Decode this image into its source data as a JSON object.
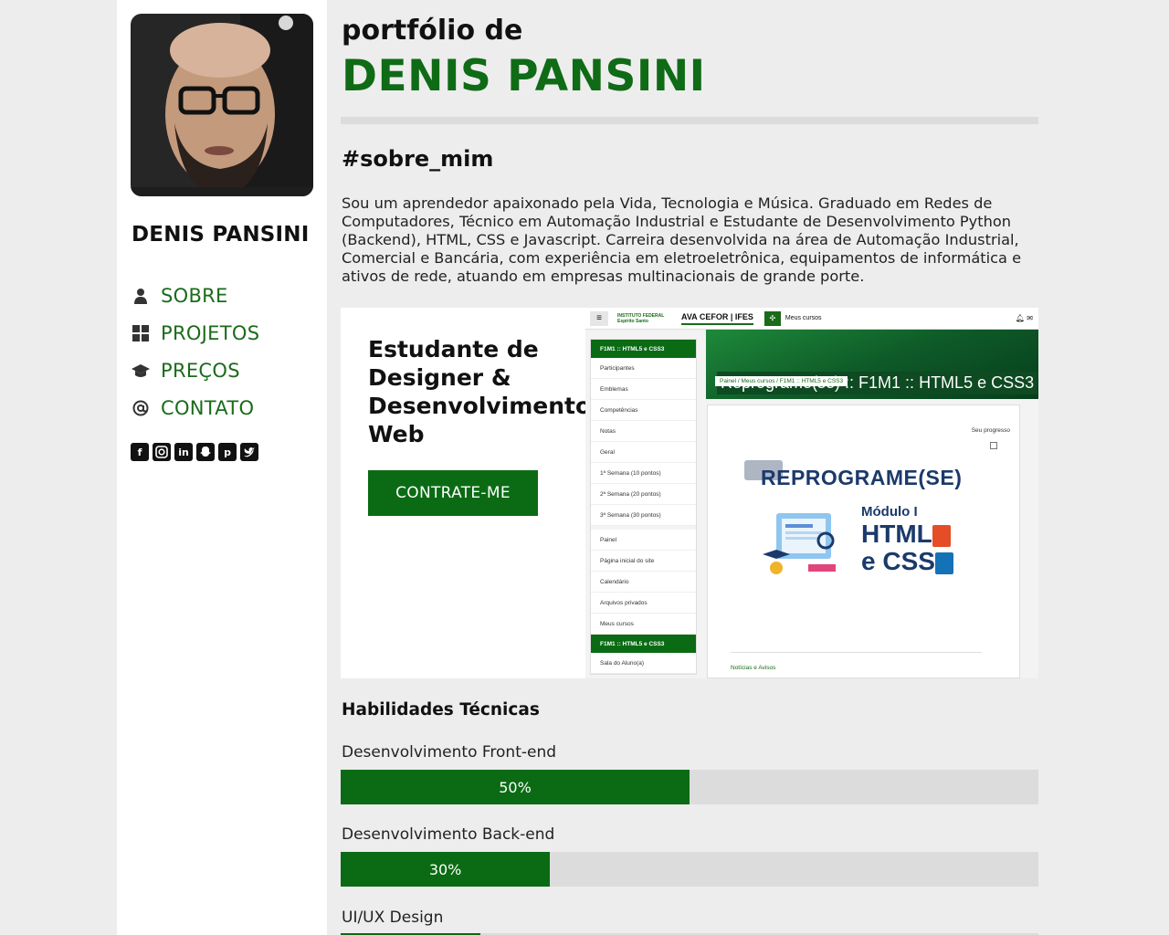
{
  "sidebar": {
    "name": "DENIS PANSINI",
    "nav": [
      {
        "label": "SOBRE",
        "icon": "user-icon"
      },
      {
        "label": "PROJETOS",
        "icon": "grid-icon"
      },
      {
        "label": "PREÇOS",
        "icon": "graduation-cap-icon"
      },
      {
        "label": "CONTATO",
        "icon": "at-sign-icon"
      }
    ],
    "socials": [
      "facebook-icon",
      "instagram-icon",
      "linkedin-icon",
      "snapchat-icon",
      "pinterest-icon",
      "twitter-icon"
    ]
  },
  "header": {
    "pre_title": "portfólio de",
    "title": "DENIS PANSINI"
  },
  "about": {
    "heading": "#sobre_mim",
    "text": "Sou um aprendedor apaixonado pela Vida, Tecnologia e Música. Graduado em Redes de Computadores, Técnico em Automação Industrial e Estudante de Desenvolvimento Python (Backend), HTML, CSS e Javascript. Carreira desenvolvida na área de Automação Industrial, Comercial e Bancária, com experiência em eletroeletrônica, equipamentos de informática e ativos de rede, atuando em empresas multinacionais de grande porte."
  },
  "hero": {
    "headline": "Estudante de Designer & Desenvolvimento Web",
    "button": "CONTRATE-ME"
  },
  "screenshot": {
    "logo": "INSTITUTO FEDERAL Espírito Santo",
    "brand": "AVA CEFOR | IFES",
    "courses": "Meus cursos",
    "sidebar_head": "F1M1 :: HTML5 e CSS3",
    "items_a": [
      "Participantes",
      "Emblemas",
      "Competências",
      "Notas",
      "Geral",
      "1ª Semana (10 pontos)",
      "2ª Semana (20 pontos)",
      "3ª Semana (30 pontos)"
    ],
    "items_b": [
      "Painel",
      "Página inicial do site",
      "Calendário",
      "Arquivos privados",
      "Meus cursos"
    ],
    "sidebar_head2": "F1M1 :: HTML5 e CSS3",
    "item_last": "Sala do Aluno(a)",
    "banner_title": "Reprograme(se) :: F1M1 :: HTML5 e CSS3",
    "breadcrumb": "Painel / Meus cursos / F1M1 :: HTML5 e CSS3",
    "progress": "Seu progresso",
    "course_logo": "REPROGRAME(SE)",
    "module": "Módulo I",
    "html_text": "HTML",
    "css_text": "e CSS",
    "news": "Notícias e Avisos"
  },
  "skills": {
    "title": "Habilidades Técnicas",
    "items": [
      {
        "label": "Desenvolvimento Front-end",
        "percent_text": "50%",
        "percent": 50
      },
      {
        "label": "Desenvolvimento Back-end",
        "percent_text": "30%",
        "percent": 30
      },
      {
        "label": "UI/UX Design",
        "percent_text": "",
        "percent": 20
      }
    ]
  },
  "colors": {
    "accent": "#0a6b14",
    "nav_text": "#1a6b1a",
    "bar_bg": "#dcdcdc"
  }
}
